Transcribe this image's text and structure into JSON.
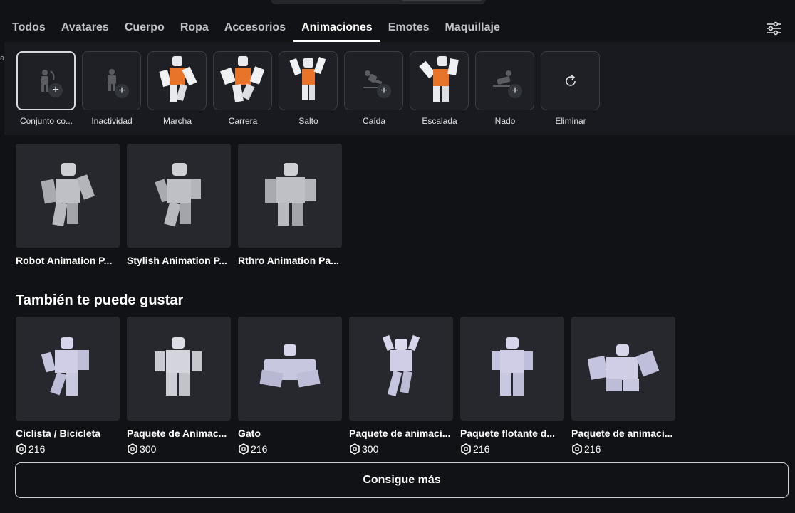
{
  "tabs": [
    "Todos",
    "Avatares",
    "Cuerpo",
    "Ropa",
    "Accesorios",
    "Animaciones",
    "Emotes",
    "Maquillaje"
  ],
  "active_tab": "Animaciones",
  "side_cut_text": "as",
  "slots": [
    {
      "label": "Conjunto co...",
      "icon": "ghost-figure-icon"
    },
    {
      "label": "Inactividad",
      "icon": "ghost-figure-icon"
    },
    {
      "label": "Marcha",
      "icon": "avatar-thumbnail"
    },
    {
      "label": "Carrera",
      "icon": "avatar-thumbnail"
    },
    {
      "label": "Salto",
      "icon": "avatar-thumbnail"
    },
    {
      "label": "Caída",
      "icon": "ghost-figure-icon"
    },
    {
      "label": "Escalada",
      "icon": "avatar-thumbnail"
    },
    {
      "label": "Nado",
      "icon": "ghost-figure-icon"
    },
    {
      "label": "Eliminar",
      "icon": "refresh-icon"
    }
  ],
  "owned": [
    {
      "name": "Robot Animation P..."
    },
    {
      "name": "Stylish Animation P..."
    },
    {
      "name": "Rthro Animation Pa..."
    }
  ],
  "recommend_title": "También te puede gustar",
  "recommended": [
    {
      "name": "Ciclista / Bicicleta",
      "price": "216"
    },
    {
      "name": "Paquete de Animac...",
      "price": "300"
    },
    {
      "name": "Gato",
      "price": "216"
    },
    {
      "name": "Paquete de animaci...",
      "price": "300"
    },
    {
      "name": "Paquete flotante d...",
      "price": "216"
    },
    {
      "name": "Paquete de animaci...",
      "price": "216"
    }
  ],
  "more_button": "Consigue más",
  "colors": {
    "background": "#111216",
    "panel": "#191a1f",
    "card": "#27282e",
    "accent": "#ffffff",
    "shirt": "#e8742a"
  }
}
